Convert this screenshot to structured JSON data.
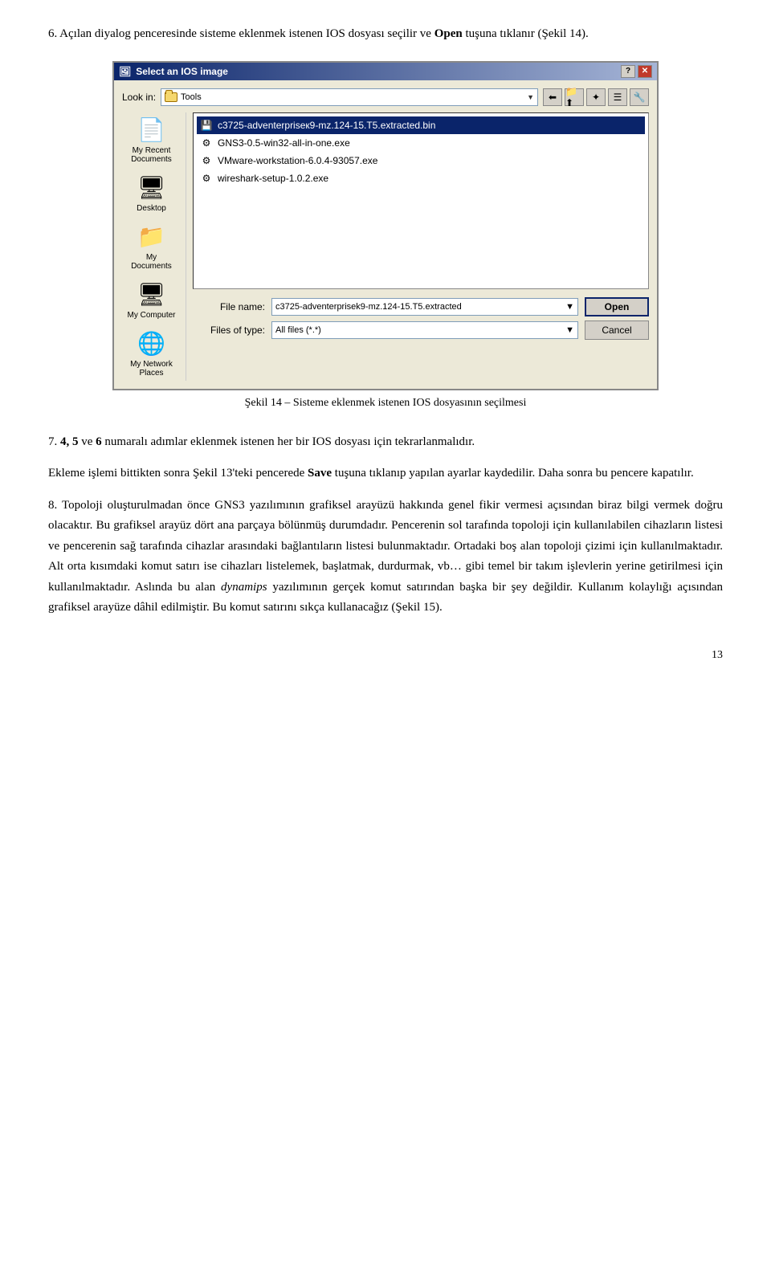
{
  "intro": {
    "text": "6. Açılan diyalog penceresinde sisteme eklenmek istenen IOS dosyası seçilir ve ",
    "bold_part": "Open",
    "text2": " tuşuna tıklanır (Şekil 14)."
  },
  "dialog": {
    "title": "Select an IOS image",
    "toolbar_label": "Look in:",
    "toolbar_value": "Tools",
    "files": [
      {
        "name": "c3725-adventerpriseк9-mz.124-15.T5.extracted.bin",
        "selected": true
      },
      {
        "name": "GNS3-0.5-win32-all-in-one.exe",
        "selected": false
      },
      {
        "name": "VMware-workstation-6.0.4-93057.exe",
        "selected": false
      },
      {
        "name": "wireshark-setup-1.0.2.exe",
        "selected": false
      }
    ],
    "sidebar_items": [
      {
        "label": "My Recent Documents",
        "icon": "📄"
      },
      {
        "label": "Desktop",
        "icon": "🖥"
      },
      {
        "label": "My Documents",
        "icon": "📁"
      },
      {
        "label": "My Computer",
        "icon": "🖥"
      },
      {
        "label": "My Network Places",
        "icon": "🌐"
      }
    ],
    "file_name_label": "File name:",
    "file_name_value": "c3725-adventerprisek9-mz.124-15.T5.extracted",
    "files_of_type_label": "Files of type:",
    "files_of_type_value": "All files (*.*)",
    "open_btn": "Open",
    "cancel_btn": "Cancel"
  },
  "caption": "Şekil 14 – Sisteme eklenmek istenen IOS dosyasının seçilmesi",
  "paragraph7": {
    "num": "7.",
    "text": " ",
    "bold_nums": "4, 5",
    "text2": " ve ",
    "bold_num3": "6",
    "text3": " numaralı adımlar eklenmek istenen her bir IOS dosyası için tekrarlanmalıdır."
  },
  "paragraph_save": {
    "text": "Ekleme işlemi bittikten sonra Şekil 13'teki pencerede ",
    "bold": "Save",
    "text2": " tuşuna tıklanıp yapılan ayarlar kaydedilir. Daha sonra bu pencere kapatılır."
  },
  "paragraph8": {
    "num": "8.",
    "text": " Topoloji oluşturulmadan önce GNS3 yazılımının grafiksel arayüzü hakkında genel fikir vermesi açısından biraz bilgi vermek doğru olacaktır. Bu grafiksel arayüz dört ana parçaya bölünmüş durumdadır. Pencerenin sol tarafında topoloji için kullanılabilen cihazların listesi ve pencerenin sağ tarafında cihazlar arasındaki bağlantıların listesi bulunmaktadır. Ortadaki boş alan topoloji çizimi için kullanılmaktadır. Alt orta kısımdaki komut satırı ise cihazları listelemek, başlatmak, durdurmak, vb… gibi temel bir takım işlevlerin yerine getirilmesi için kullanılmaktadır. Aslında bu alan ",
    "italic": "dynamips",
    "text2": " yazılımının gerçek komut satırından başka bir şey değildir. Kullanım kolaylığı açısından grafiksel arayüze dâhil edilmiştir. Bu komut satırını sıkça kullanacağız (Şekil 15)."
  },
  "page_number": "13"
}
